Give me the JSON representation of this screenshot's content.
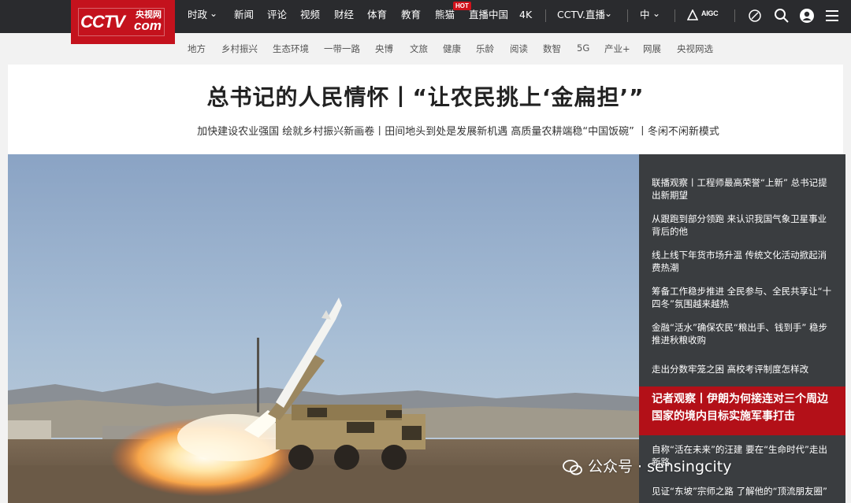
{
  "topnav": {
    "logo_text": "CCTV",
    "logo_cn": "央视网",
    "logo_com": "com",
    "items": [
      "时政",
      "新闻",
      "评论",
      "视频",
      "财经",
      "体育",
      "教育",
      "熊猫",
      "直播中国",
      "4K",
      "CCTV.直播",
      "中"
    ],
    "hot_badge": "HOT",
    "aigc_label": "AIGC"
  },
  "subnav": [
    "地方",
    "乡村振兴",
    "生态环境",
    "一带一路",
    "央博",
    "文旅",
    "健康",
    "乐龄",
    "阅读",
    "数智",
    "5G",
    "产业+",
    "网展",
    "央视网选"
  ],
  "headline": {
    "title": "总书记的人民情怀丨“让农民挑上‘金扁担’”",
    "subtitle": "加快建设农业强国 绘就乡村振兴新画卷丨田间地头到处是发展新机遇 高质量农耕端稳“中国饭碗” 丨冬闲不闲新模式"
  },
  "side_links": [
    "联播观察丨工程师最高荣誉“上新” 总书记提出新期望",
    "从跟跑到部分领跑 来认识我国气象卫星事业背后的他",
    "线上线下年货市场升温 传统文化活动掀起消费热潮",
    "筹备工作稳步推进 全民参与、全民共享让“十四冬”氛围越来越热",
    "金融“活水”确保农民“粮出手、钱到手” 稳步推进秋粮收购",
    "走出分数牢笼之困 高校考评制度怎样改"
  ],
  "feature": {
    "title": "记者观察丨伊朗为何接连对三个周边国家的境内目标实施军事打击"
  },
  "side_links_bottom": [
    "自称“活在未来”的汪建 要在“生命时代”走出新路",
    "见证“东坡”宗师之路 了解他的“顶流朋友圈”"
  ],
  "watermark": "公众号 · sensingcity",
  "colors": {
    "brand_red": "#c4121d",
    "topbar": "#2a2b2e",
    "feature_red": "#b31018"
  }
}
